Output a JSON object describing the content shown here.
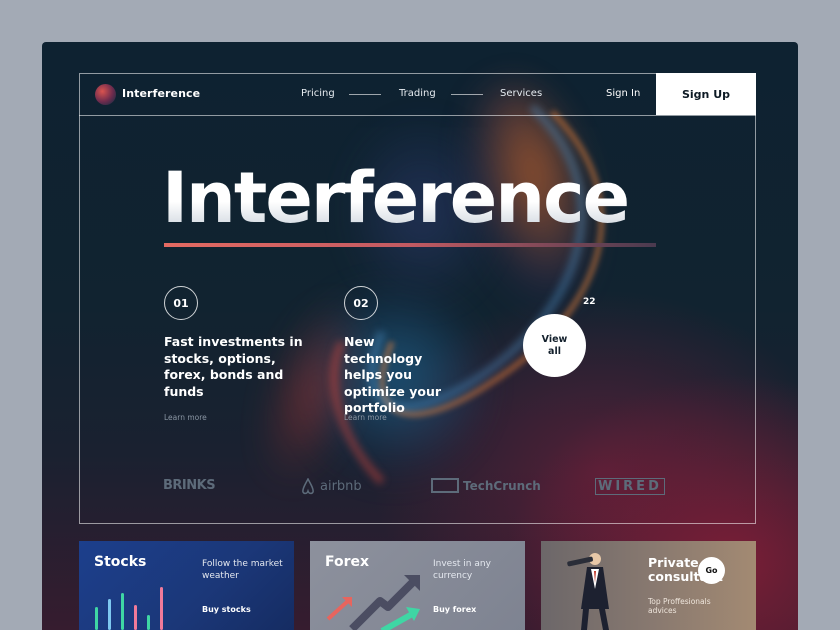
{
  "nav": {
    "brand": "Interference",
    "links": [
      "Pricing",
      "Trading",
      "Services"
    ],
    "sign_in": "Sign In",
    "sign_up": "Sign Up"
  },
  "hero": {
    "title": "Interference",
    "features": [
      {
        "number": "01",
        "text": "Fast investments in stocks, options, forex, bonds and funds",
        "link": "Learn more"
      },
      {
        "number": "02",
        "text": "New technology helps you optimize your portfolio",
        "link": "Learn more"
      }
    ],
    "counter": "22",
    "view_all": "View all"
  },
  "partners": [
    "BRINKS",
    "airbnb",
    "TechCrunch",
    "WIRED"
  ],
  "cards": [
    {
      "title": "Stocks",
      "subtitle": "Follow the market weather",
      "cta": "Buy stocks"
    },
    {
      "title": "Forex",
      "subtitle": "Invest in any currency",
      "cta": "Buy forex"
    },
    {
      "title": "Private consultant",
      "subtitle": "Top Proffesionals advices",
      "cta": "Go"
    }
  ],
  "colors": {
    "background": "#0e2231",
    "accent_gradient_start": "#e46a62",
    "stocks_card": "#1c3f8c",
    "forex_card": "#8d919d",
    "consultant_card": "#8a7a70"
  }
}
